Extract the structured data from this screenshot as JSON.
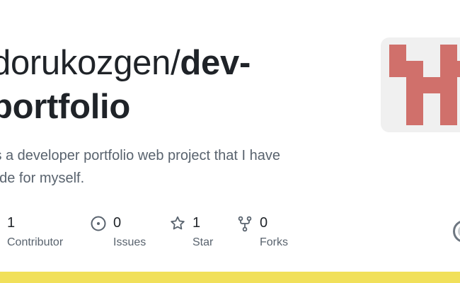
{
  "repo": {
    "owner": "dorukozgen/",
    "name_part1": "dev-",
    "name_part2": "portfolio",
    "description_line1": "is a developer portfolio web project that I have",
    "description_line2": "ade for myself."
  },
  "stats": [
    {
      "count": "1",
      "label": "Contributor",
      "icon": "people-icon"
    },
    {
      "count": "0",
      "label": "Issues",
      "icon": "issue-opened-icon"
    },
    {
      "count": "1",
      "label": "Star",
      "icon": "star-icon"
    },
    {
      "count": "0",
      "label": "Forks",
      "icon": "repo-forked-icon"
    }
  ],
  "colors": {
    "title": "#1f2328",
    "muted": "#59636e",
    "identicon": "#d0706b",
    "identicon_bg": "#f0f0f0",
    "language_bar": "#f1e05a"
  },
  "icons": {
    "avatar": "identicon-avatar",
    "logo": "github-logo-icon"
  }
}
